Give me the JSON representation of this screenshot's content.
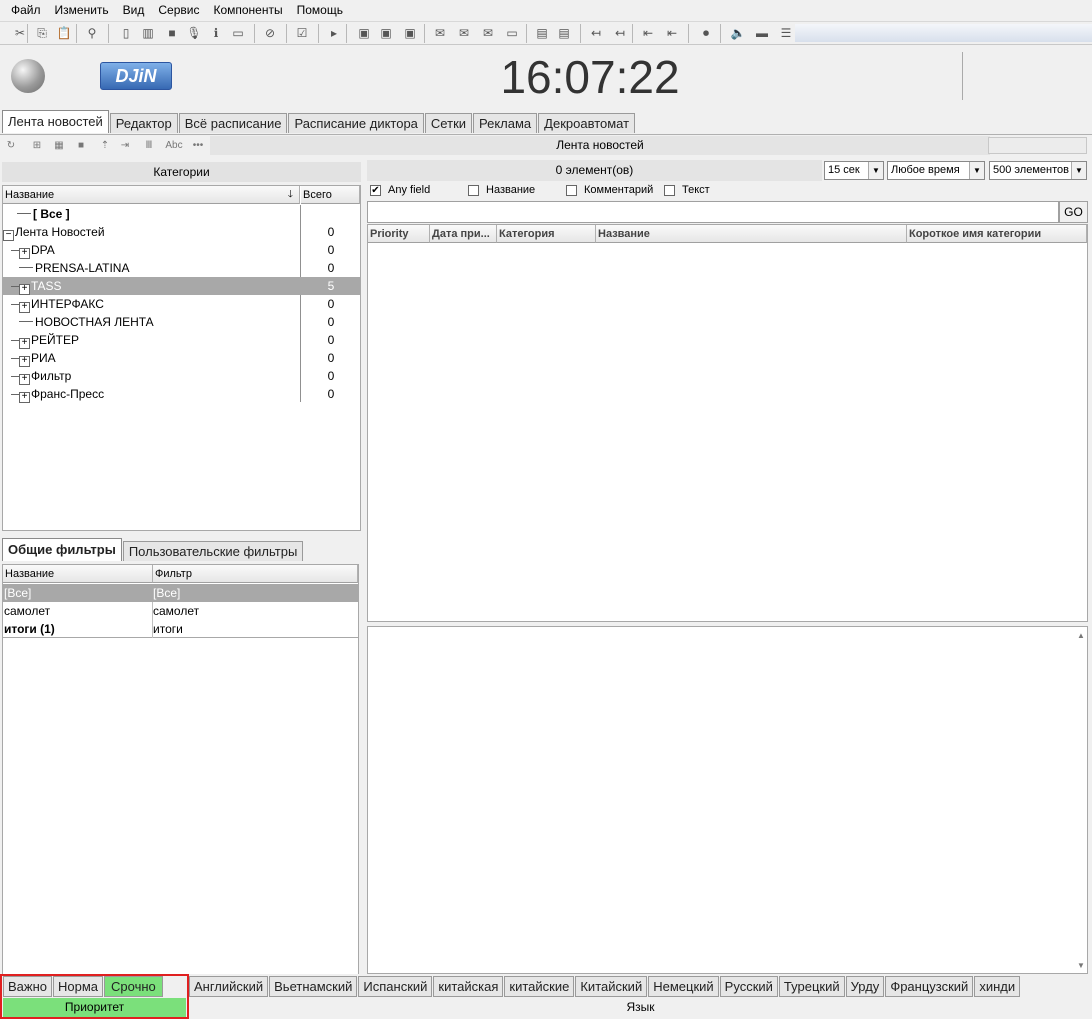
{
  "menu": [
    "Файл",
    "Изменить",
    "Вид",
    "Сервис",
    "Компоненты",
    "Помощь"
  ],
  "header": {
    "clock": "16:07:22",
    "logo_text": "DJiN"
  },
  "main_tabs": [
    "Лента новостей",
    "Редактор",
    "Всё расписание",
    "Расписание диктора",
    "Сетки",
    "Реклама",
    "Декроавтомат"
  ],
  "sub_toolbar": {
    "title": "Лента новостей"
  },
  "categories": {
    "title": "Категории",
    "col_name": "Название",
    "col_total": "Всего",
    "rows": [
      {
        "label": "[ Все ]",
        "count": "",
        "expander": "",
        "bold": true,
        "indent": 14
      },
      {
        "label": "Лента Новостей",
        "count": "0",
        "expander": "−",
        "bold": false,
        "indent": 0
      },
      {
        "label": "DPA",
        "count": "0",
        "expander": "+",
        "bold": false,
        "indent": 16
      },
      {
        "label": "PRENSA-LATINA",
        "count": "0",
        "expander": "",
        "bold": false,
        "indent": 16
      },
      {
        "label": "TASS",
        "count": "5",
        "expander": "+",
        "bold": false,
        "indent": 16,
        "selected": true
      },
      {
        "label": "ИНТЕРФАКС",
        "count": "0",
        "expander": "+",
        "bold": false,
        "indent": 16
      },
      {
        "label": "НОВОСТНАЯ ЛЕНТА",
        "count": "0",
        "expander": "",
        "bold": false,
        "indent": 16
      },
      {
        "label": "РЕЙТЕР",
        "count": "0",
        "expander": "+",
        "bold": false,
        "indent": 16
      },
      {
        "label": "РИА",
        "count": "0",
        "expander": "+",
        "bold": false,
        "indent": 16
      },
      {
        "label": "Фильтр",
        "count": "0",
        "expander": "+",
        "bold": false,
        "indent": 16
      },
      {
        "label": "Франс-Пресс",
        "count": "0",
        "expander": "+",
        "bold": false,
        "indent": 16
      }
    ]
  },
  "filter_tabs": [
    "Общие фильтры",
    "Пользовательские фильтры"
  ],
  "filters": {
    "col_name": "Название",
    "col_filter": "Фильтр",
    "rows": [
      {
        "name": "[Все]",
        "filter": "[Все]",
        "selected": true,
        "bold": false
      },
      {
        "name": "самолет",
        "filter": "самолет",
        "selected": false,
        "bold": false
      },
      {
        "name": "итоги (1)",
        "filter": "итоги",
        "selected": false,
        "bold": true
      }
    ]
  },
  "news": {
    "count_label": "0 элемент(ов)",
    "refresh": "15 сек",
    "time": "Любое время",
    "limit": "500 элементов",
    "checks": [
      {
        "label": "Any field",
        "checked": true
      },
      {
        "label": "Название",
        "checked": false
      },
      {
        "label": "Комментарий",
        "checked": false
      },
      {
        "label": "Текст",
        "checked": false
      }
    ],
    "go_label": "GO",
    "columns": [
      "Priority",
      "Дата при...",
      "Категория",
      "Название",
      "Короткое имя категории"
    ]
  },
  "priority": {
    "tabs": [
      "Важно",
      "Норма",
      "Срочно"
    ],
    "active": "Срочно",
    "label": "Приоритет"
  },
  "language": {
    "tabs": [
      "Английский",
      "Вьетнамский",
      "Испанский",
      "китайская",
      "китайские",
      "Китайский",
      "Немецкий",
      "Русский",
      "Турецкий",
      "Урду",
      "Французский",
      "хинди"
    ],
    "label": "Язык"
  },
  "colors": {
    "selection": "#a8a8a8",
    "priority_green": "#7be07b",
    "highlight_red": "#e02020"
  }
}
